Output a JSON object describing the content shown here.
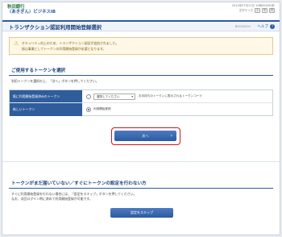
{
  "header": {
    "bank_name": "秋田銀行",
    "service_name": "〈あきぎん〉ビジネスIB",
    "login_info": "2012年07月11日 10時00分00秒",
    "font_size_label": "文字サイズ",
    "font_small": "小",
    "font_medium": "中",
    "font_large": "大"
  },
  "titlebar": {
    "title": "トランザクション認証利用開始登録選択",
    "screen_id": "BSCD2001",
    "help_label": "ヘルプ",
    "help_icon_glyph": "?"
  },
  "warning": {
    "line1": "セキュリティ向上のため、トランザクション認証が追加されました。",
    "line2": "振込事業としてトークンの利用開始登録が必要となります。",
    "icon_glyph": "⚠"
  },
  "token_section": {
    "title": "ご使用するトークンを選択",
    "description": "利用トークンを選択の上、「次へ」ボタンを押してください。",
    "row1_label": "既に利用開始登録済みのトークン",
    "row1_select_value": "選択してください",
    "row1_hint": "お手持ちのトークンに表示されるトークンコード",
    "row2_label": "新しいトークン",
    "row2_value": "利用開始登録"
  },
  "next_button": {
    "label": "次へ",
    "arrow": "›"
  },
  "help_section": {
    "title": "トークンがまだ届いていない／すぐにトークンの設定を行わない方",
    "desc_line1": "すぐに利用開始登録を行わない場合には、「設定をスキップ」ボタンを押してください。",
    "desc_line2": "なお、次回ログイン時に改めて利用開始登録が可能です。",
    "skip_button": "設定をスキップ"
  }
}
